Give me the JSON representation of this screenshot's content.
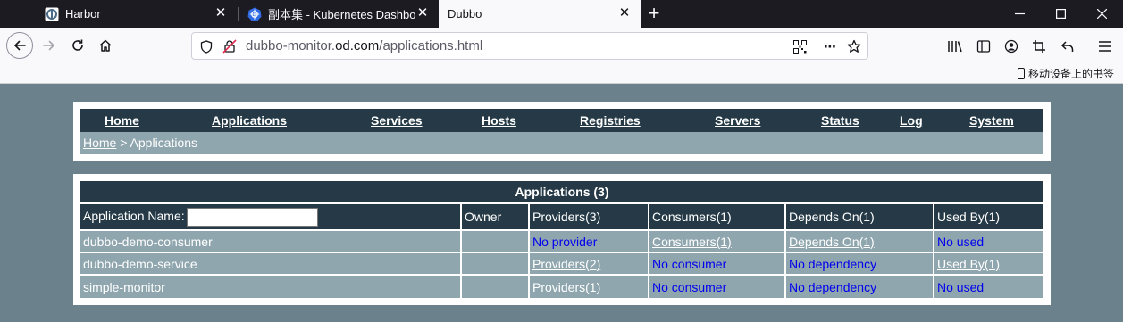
{
  "browser": {
    "tabs": [
      {
        "title": "Harbor",
        "favicon": "harbor-icon"
      },
      {
        "title": "副本集 - Kubernetes Dashboard",
        "favicon": "kubernetes-icon"
      },
      {
        "title": "Dubbo",
        "favicon": ""
      }
    ],
    "url_prefix": "dubbo-monitor.",
    "url_host": "od.com",
    "url_suffix": "/applications.html",
    "bookmark_mobile": "移动设备上的书签"
  },
  "menu": {
    "home": "Home",
    "applications": "Applications",
    "services": "Services",
    "hosts": "Hosts",
    "registries": "Registries",
    "servers": "Servers",
    "status": "Status",
    "log": "Log",
    "system": "System"
  },
  "breadcrumb": {
    "home": "Home",
    "separator": " > ",
    "current": "Applications"
  },
  "applications": {
    "caption": "Applications (3)",
    "headers": {
      "name": "Application Name:",
      "owner": "Owner",
      "providers": "Providers(3)",
      "consumers": "Consumers(1)",
      "depends": "Depends On(1)",
      "used_by": "Used By(1)"
    },
    "name_filter_value": "",
    "rows": [
      {
        "name": "dubbo-demo-consumer",
        "owner": "",
        "providers": "No provider",
        "consumers": "Consumers(1)",
        "depends": "Depends On(1)",
        "used_by": "No used"
      },
      {
        "name": "dubbo-demo-service",
        "owner": "",
        "providers": "Providers(2)",
        "consumers": "No consumer",
        "depends": "No dependency",
        "used_by": "Used By(1)"
      },
      {
        "name": "simple-monitor",
        "owner": "",
        "providers": "Providers(1)",
        "consumers": "No consumer",
        "depends": "No dependency",
        "used_by": "No used"
      }
    ]
  },
  "colors": {
    "page_bg": "#6b828d",
    "header_bg": "#253a46",
    "row_bg": "#8fa6ae",
    "link_blue": "#0000ee"
  }
}
